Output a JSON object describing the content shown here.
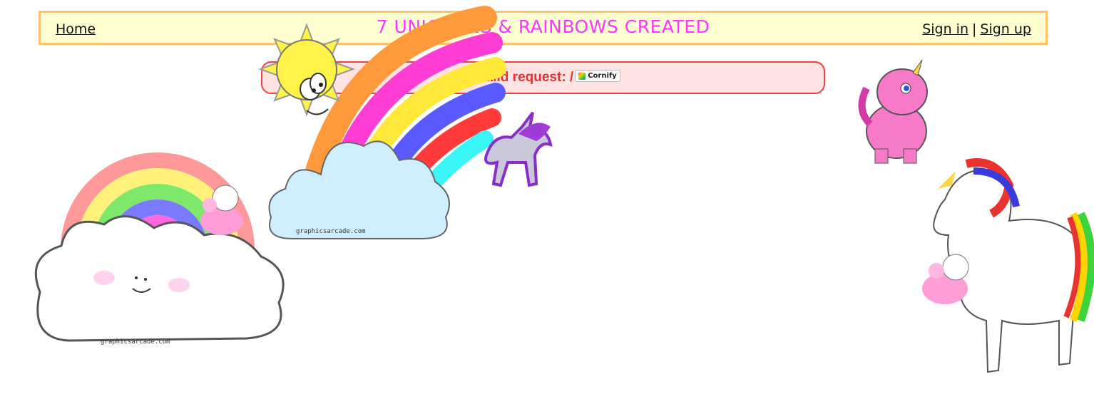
{
  "header": {
    "home_label": "Home",
    "title": "7 UNICORNS & RAINBOWS CREATED",
    "sign_in_label": "Sign in",
    "separator": "|",
    "sign_up_label": "Sign up"
  },
  "error": {
    "message": "Invalid request: /",
    "cornify_label": "Cornify"
  },
  "stickers": {
    "watermark": "graphicsarcade.com"
  },
  "colors": {
    "title": "#ff33ff",
    "header_bg": "#ffffd1",
    "header_border": "#ffc46b",
    "error_bg": "#ffe2e2",
    "error_text": "#e03434"
  }
}
